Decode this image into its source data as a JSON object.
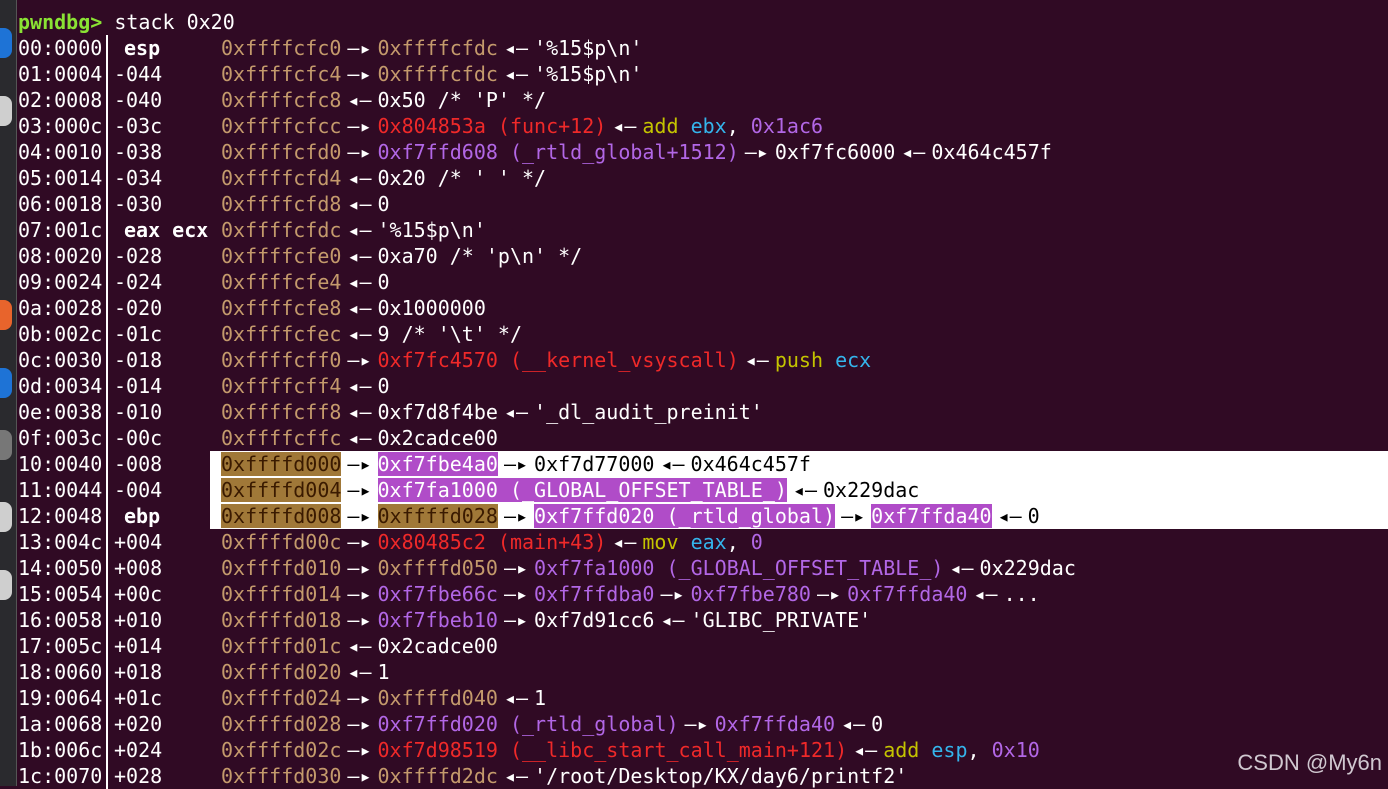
{
  "prompt": "pwndbg>",
  "command": "stack 0x20",
  "arrow_right": "—▸",
  "arrow_left": "◂—",
  "watermark": "CSDN @My6n",
  "colors": {
    "background": "#300a24",
    "prompt": "#8ae234",
    "stack_address": "#c49a6c",
    "data_address": "#b267e6",
    "code_address": "#ef2929",
    "instruction": "#c4c400",
    "register": "#34b4eb",
    "highlight_row": "#ffffff"
  },
  "rows": [
    {
      "index": "00:0000",
      "offset": "",
      "reg": "esp",
      "highlighted": false,
      "chain": [
        {
          "t": "stack",
          "v": "0xffffcfc0"
        },
        {
          "t": "ar"
        },
        {
          "t": "stack",
          "v": "0xffffcfdc"
        },
        {
          "t": "al"
        },
        {
          "t": "plain",
          "v": "'%15$p\\n'"
        }
      ]
    },
    {
      "index": "01:0004",
      "offset": "-044",
      "reg": "",
      "highlighted": false,
      "chain": [
        {
          "t": "stack",
          "v": "0xffffcfc4"
        },
        {
          "t": "ar"
        },
        {
          "t": "stack",
          "v": "0xffffcfdc"
        },
        {
          "t": "al"
        },
        {
          "t": "plain",
          "v": "'%15$p\\n'"
        }
      ]
    },
    {
      "index": "02:0008",
      "offset": "-040",
      "reg": "",
      "highlighted": false,
      "chain": [
        {
          "t": "stack",
          "v": "0xffffcfc8"
        },
        {
          "t": "al"
        },
        {
          "t": "plain",
          "v": "0x50 /* 'P' */"
        }
      ]
    },
    {
      "index": "03:000c",
      "offset": "-03c",
      "reg": "",
      "highlighted": false,
      "chain": [
        {
          "t": "stack",
          "v": "0xffffcfcc"
        },
        {
          "t": "ar"
        },
        {
          "t": "code",
          "v": "0x804853a (func+12)"
        },
        {
          "t": "al"
        },
        {
          "t": "ins",
          "v": "add"
        },
        {
          "t": "plain",
          "v": " "
        },
        {
          "t": "reg",
          "v": "ebx"
        },
        {
          "t": "plain",
          "v": ", "
        },
        {
          "t": "imm",
          "v": "0x1ac6"
        }
      ]
    },
    {
      "index": "04:0010",
      "offset": "-038",
      "reg": "",
      "highlighted": false,
      "chain": [
        {
          "t": "stack",
          "v": "0xffffcfd0"
        },
        {
          "t": "ar"
        },
        {
          "t": "data",
          "v": "0xf7ffd608 (_rtld_global+1512)"
        },
        {
          "t": "ar"
        },
        {
          "t": "plain",
          "v": "0xf7fc6000"
        },
        {
          "t": "al"
        },
        {
          "t": "plain",
          "v": "0x464c457f"
        }
      ]
    },
    {
      "index": "05:0014",
      "offset": "-034",
      "reg": "",
      "highlighted": false,
      "chain": [
        {
          "t": "stack",
          "v": "0xffffcfd4"
        },
        {
          "t": "al"
        },
        {
          "t": "plain",
          "v": "0x20 /* ' ' */"
        }
      ]
    },
    {
      "index": "06:0018",
      "offset": "-030",
      "reg": "",
      "highlighted": false,
      "chain": [
        {
          "t": "stack",
          "v": "0xffffcfd8"
        },
        {
          "t": "al"
        },
        {
          "t": "plain",
          "v": "0"
        }
      ]
    },
    {
      "index": "07:001c",
      "offset": "",
      "reg": "eax ecx",
      "highlighted": false,
      "chain": [
        {
          "t": "stack",
          "v": "0xffffcfdc"
        },
        {
          "t": "al"
        },
        {
          "t": "plain",
          "v": "'%15$p\\n'"
        }
      ]
    },
    {
      "index": "08:0020",
      "offset": "-028",
      "reg": "",
      "highlighted": false,
      "chain": [
        {
          "t": "stack",
          "v": "0xffffcfe0"
        },
        {
          "t": "al"
        },
        {
          "t": "plain",
          "v": "0xa70 /* 'p\\n' */"
        }
      ]
    },
    {
      "index": "09:0024",
      "offset": "-024",
      "reg": "",
      "highlighted": false,
      "chain": [
        {
          "t": "stack",
          "v": "0xffffcfe4"
        },
        {
          "t": "al"
        },
        {
          "t": "plain",
          "v": "0"
        }
      ]
    },
    {
      "index": "0a:0028",
      "offset": "-020",
      "reg": "",
      "highlighted": false,
      "chain": [
        {
          "t": "stack",
          "v": "0xffffcfe8"
        },
        {
          "t": "al"
        },
        {
          "t": "plain",
          "v": "0x1000000"
        }
      ]
    },
    {
      "index": "0b:002c",
      "offset": "-01c",
      "reg": "",
      "highlighted": false,
      "chain": [
        {
          "t": "stack",
          "v": "0xffffcfec"
        },
        {
          "t": "al"
        },
        {
          "t": "plain",
          "v": "9 /* '\\t' */"
        }
      ]
    },
    {
      "index": "0c:0030",
      "offset": "-018",
      "reg": "",
      "highlighted": false,
      "chain": [
        {
          "t": "stack",
          "v": "0xffffcff0"
        },
        {
          "t": "ar"
        },
        {
          "t": "code",
          "v": "0xf7fc4570 (__kernel_vsyscall)"
        },
        {
          "t": "al"
        },
        {
          "t": "ins",
          "v": "push"
        },
        {
          "t": "plain",
          "v": " "
        },
        {
          "t": "reg",
          "v": "ecx"
        }
      ]
    },
    {
      "index": "0d:0034",
      "offset": "-014",
      "reg": "",
      "highlighted": false,
      "chain": [
        {
          "t": "stack",
          "v": "0xffffcff4"
        },
        {
          "t": "al"
        },
        {
          "t": "plain",
          "v": "0"
        }
      ]
    },
    {
      "index": "0e:0038",
      "offset": "-010",
      "reg": "",
      "highlighted": false,
      "chain": [
        {
          "t": "stack",
          "v": "0xffffcff8"
        },
        {
          "t": "al"
        },
        {
          "t": "plain",
          "v": "0xf7d8f4be"
        },
        {
          "t": "al"
        },
        {
          "t": "plain",
          "v": "'_dl_audit_preinit'"
        }
      ]
    },
    {
      "index": "0f:003c",
      "offset": "-00c",
      "reg": "",
      "highlighted": false,
      "chain": [
        {
          "t": "stack",
          "v": "0xffffcffc"
        },
        {
          "t": "al"
        },
        {
          "t": "plain",
          "v": "0x2cadce00"
        }
      ]
    },
    {
      "index": "10:0040",
      "offset": "-008",
      "reg": "",
      "highlighted": true,
      "chain": [
        {
          "t": "stack",
          "v": "0xffffd000"
        },
        {
          "t": "ar"
        },
        {
          "t": "data",
          "v": "0xf7fbe4a0"
        },
        {
          "t": "ar"
        },
        {
          "t": "plain",
          "v": "0xf7d77000"
        },
        {
          "t": "al"
        },
        {
          "t": "plain",
          "v": "0x464c457f"
        }
      ]
    },
    {
      "index": "11:0044",
      "offset": "-004",
      "reg": "",
      "highlighted": true,
      "chain": [
        {
          "t": "stack",
          "v": "0xffffd004"
        },
        {
          "t": "ar"
        },
        {
          "t": "data",
          "v": "0xf7fa1000 (_GLOBAL_OFFSET_TABLE_)"
        },
        {
          "t": "al"
        },
        {
          "t": "plain",
          "v": "0x229dac"
        }
      ]
    },
    {
      "index": "12:0048",
      "offset": "",
      "reg": "ebp",
      "highlighted": true,
      "chain": [
        {
          "t": "stack",
          "v": "0xffffd008"
        },
        {
          "t": "ar"
        },
        {
          "t": "stack",
          "v": "0xffffd028"
        },
        {
          "t": "ar"
        },
        {
          "t": "data",
          "v": "0xf7ffd020 (_rtld_global)"
        },
        {
          "t": "ar"
        },
        {
          "t": "data",
          "v": "0xf7ffda40"
        },
        {
          "t": "al"
        },
        {
          "t": "plain",
          "v": "0"
        }
      ]
    },
    {
      "index": "13:004c",
      "offset": "+004",
      "reg": "",
      "highlighted": false,
      "chain": [
        {
          "t": "stack",
          "v": "0xffffd00c"
        },
        {
          "t": "ar"
        },
        {
          "t": "code",
          "v": "0x80485c2 (main+43)"
        },
        {
          "t": "al"
        },
        {
          "t": "ins",
          "v": "mov"
        },
        {
          "t": "plain",
          "v": " "
        },
        {
          "t": "reg",
          "v": "eax"
        },
        {
          "t": "plain",
          "v": ", "
        },
        {
          "t": "imm",
          "v": "0"
        }
      ]
    },
    {
      "index": "14:0050",
      "offset": "+008",
      "reg": "",
      "highlighted": false,
      "chain": [
        {
          "t": "stack",
          "v": "0xffffd010"
        },
        {
          "t": "ar"
        },
        {
          "t": "stack",
          "v": "0xffffd050"
        },
        {
          "t": "ar"
        },
        {
          "t": "data",
          "v": "0xf7fa1000 (_GLOBAL_OFFSET_TABLE_)"
        },
        {
          "t": "al"
        },
        {
          "t": "plain",
          "v": "0x229dac"
        }
      ]
    },
    {
      "index": "15:0054",
      "offset": "+00c",
      "reg": "",
      "highlighted": false,
      "chain": [
        {
          "t": "stack",
          "v": "0xffffd014"
        },
        {
          "t": "ar"
        },
        {
          "t": "data",
          "v": "0xf7fbe66c"
        },
        {
          "t": "ar"
        },
        {
          "t": "data",
          "v": "0xf7ffdba0"
        },
        {
          "t": "ar"
        },
        {
          "t": "data",
          "v": "0xf7fbe780"
        },
        {
          "t": "ar"
        },
        {
          "t": "data",
          "v": "0xf7ffda40"
        },
        {
          "t": "al"
        },
        {
          "t": "plain",
          "v": "..."
        }
      ]
    },
    {
      "index": "16:0058",
      "offset": "+010",
      "reg": "",
      "highlighted": false,
      "chain": [
        {
          "t": "stack",
          "v": "0xffffd018"
        },
        {
          "t": "ar"
        },
        {
          "t": "data",
          "v": "0xf7fbeb10"
        },
        {
          "t": "ar"
        },
        {
          "t": "plain",
          "v": "0xf7d91cc6"
        },
        {
          "t": "al"
        },
        {
          "t": "plain",
          "v": "'GLIBC_PRIVATE'"
        }
      ]
    },
    {
      "index": "17:005c",
      "offset": "+014",
      "reg": "",
      "highlighted": false,
      "chain": [
        {
          "t": "stack",
          "v": "0xffffd01c"
        },
        {
          "t": "al"
        },
        {
          "t": "plain",
          "v": "0x2cadce00"
        }
      ]
    },
    {
      "index": "18:0060",
      "offset": "+018",
      "reg": "",
      "highlighted": false,
      "chain": [
        {
          "t": "stack",
          "v": "0xffffd020"
        },
        {
          "t": "al"
        },
        {
          "t": "plain",
          "v": "1"
        }
      ]
    },
    {
      "index": "19:0064",
      "offset": "+01c",
      "reg": "",
      "highlighted": false,
      "chain": [
        {
          "t": "stack",
          "v": "0xffffd024"
        },
        {
          "t": "ar"
        },
        {
          "t": "stack",
          "v": "0xffffd040"
        },
        {
          "t": "al"
        },
        {
          "t": "plain",
          "v": "1"
        }
      ]
    },
    {
      "index": "1a:0068",
      "offset": "+020",
      "reg": "",
      "highlighted": false,
      "chain": [
        {
          "t": "stack",
          "v": "0xffffd028"
        },
        {
          "t": "ar"
        },
        {
          "t": "data",
          "v": "0xf7ffd020 (_rtld_global)"
        },
        {
          "t": "ar"
        },
        {
          "t": "data",
          "v": "0xf7ffda40"
        },
        {
          "t": "al"
        },
        {
          "t": "plain",
          "v": "0"
        }
      ]
    },
    {
      "index": "1b:006c",
      "offset": "+024",
      "reg": "",
      "highlighted": false,
      "chain": [
        {
          "t": "stack",
          "v": "0xffffd02c"
        },
        {
          "t": "ar"
        },
        {
          "t": "code",
          "v": "0xf7d98519 (__libc_start_call_main+121)"
        },
        {
          "t": "al"
        },
        {
          "t": "ins",
          "v": "add"
        },
        {
          "t": "plain",
          "v": " "
        },
        {
          "t": "reg",
          "v": "esp"
        },
        {
          "t": "plain",
          "v": ", "
        },
        {
          "t": "imm",
          "v": "0x10"
        }
      ]
    },
    {
      "index": "1c:0070",
      "offset": "+028",
      "reg": "",
      "highlighted": false,
      "chain": [
        {
          "t": "stack",
          "v": "0xffffd030"
        },
        {
          "t": "ar"
        },
        {
          "t": "stack",
          "v": "0xffffd2dc"
        },
        {
          "t": "al"
        },
        {
          "t": "plain",
          "v": "'/root/Desktop/KX/day6/printf2'"
        }
      ]
    }
  ]
}
